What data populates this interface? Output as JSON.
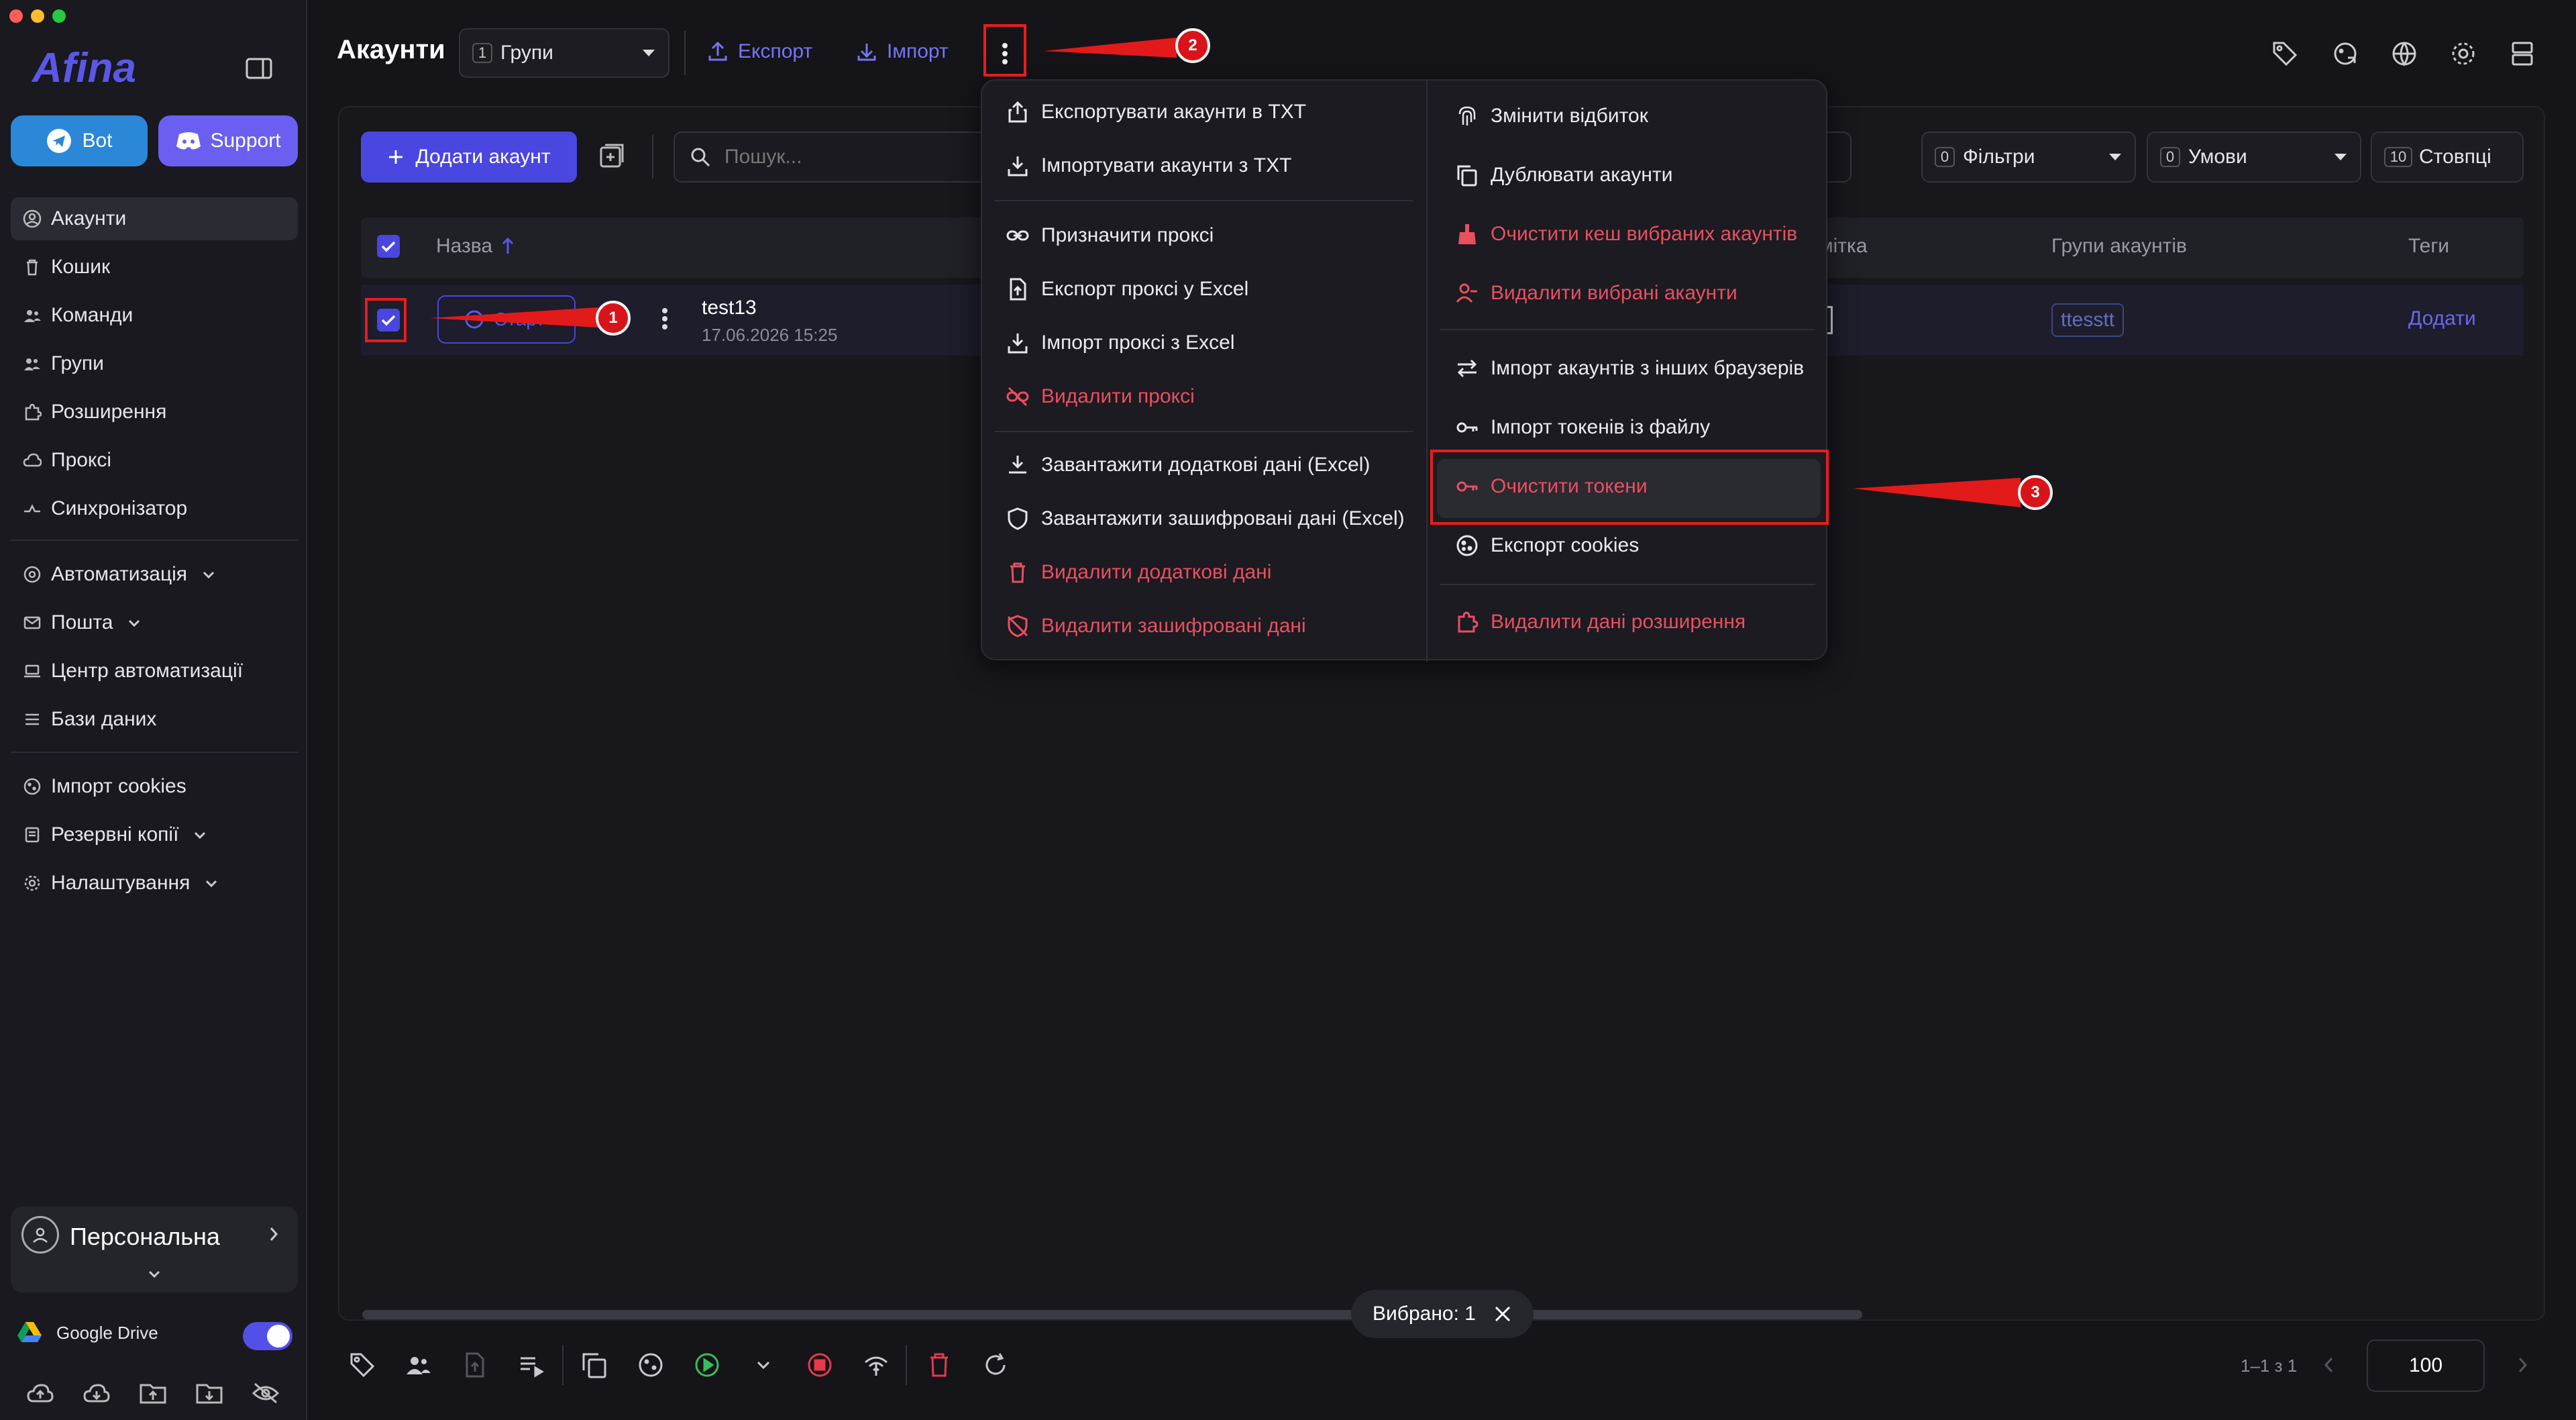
{
  "colors": {
    "accent": "#4a46e0",
    "danger": "#ea4f5f",
    "annotation": "#ea1c1c"
  },
  "sidebar": {
    "logo": "Afina",
    "bot_label": "Bot",
    "support_label": "Support",
    "items": [
      {
        "label": "Акаунти",
        "icon": "user-circle-icon"
      },
      {
        "label": "Кошик",
        "icon": "trash-icon"
      },
      {
        "label": "Команди",
        "icon": "team-icon"
      },
      {
        "label": "Групи",
        "icon": "group-icon"
      },
      {
        "label": "Розширення",
        "icon": "puzzle-icon"
      },
      {
        "label": "Проксі",
        "icon": "cloud-icon"
      },
      {
        "label": "Синхронізатор",
        "icon": "sync-icon"
      },
      {
        "label": "Автоматизація",
        "icon": "automation-icon"
      },
      {
        "label": "Пошта",
        "icon": "mail-icon"
      },
      {
        "label": "Центр автоматизації",
        "icon": "laptop-icon"
      },
      {
        "label": "Бази даних",
        "icon": "list-icon"
      },
      {
        "label": "Імпорт cookies",
        "icon": "cookie-icon"
      },
      {
        "label": "Резервні копії",
        "icon": "backup-icon"
      },
      {
        "label": "Налаштування",
        "icon": "gear-icon"
      }
    ],
    "profile_label": "Персональна",
    "drive_label": "Google Drive",
    "drive_enabled": true
  },
  "header": {
    "title": "Акаунти",
    "groups_count": "1",
    "groups_label": "Групи",
    "export_label": "Експорт",
    "import_label": "Імпорт"
  },
  "toolbar": {
    "add_label": "Додати акаунт",
    "search_placeholder": "Пошук...",
    "filters_count": "0",
    "filters_label": "Фільтри",
    "conditions_count": "0",
    "conditions_label": "Умови",
    "columns_count": "10",
    "columns_label": "Стовпці"
  },
  "table": {
    "headers": {
      "name": "Назва",
      "note": "мітка",
      "groups": "Групи акаунтів",
      "tags": "Теги"
    },
    "rows": [
      {
        "name": "test13",
        "date": "17.06.2026 15:25",
        "group": "ttesstt",
        "tags_action": "Додати",
        "start_label": "Старт"
      }
    ]
  },
  "menu": {
    "left": [
      {
        "label": "Експортувати акаунти в TXT",
        "icon": "export-icon",
        "danger": false
      },
      {
        "label": "Імпортувати акаунти з TXT",
        "icon": "import-icon",
        "danger": false
      },
      {
        "label": "Призначити проксі",
        "icon": "link-icon",
        "danger": false
      },
      {
        "label": "Експорт проксі у Excel",
        "icon": "file-export-icon",
        "danger": false
      },
      {
        "label": "Імпорт проксі з Excel",
        "icon": "download-icon",
        "danger": false
      },
      {
        "label": "Видалити проксі",
        "icon": "link-off-icon",
        "danger": true
      },
      {
        "label": "Завантажити додаткові дані (Excel)",
        "icon": "download-tray-icon",
        "danger": false
      },
      {
        "label": "Завантажити зашифровані дані (Excel)",
        "icon": "shield-icon",
        "danger": false
      },
      {
        "label": "Видалити додаткові дані",
        "icon": "trash-icon",
        "danger": true
      },
      {
        "label": "Видалити зашифровані дані",
        "icon": "shield-off-icon",
        "danger": true
      }
    ],
    "right": [
      {
        "label": "Змінити відбиток",
        "icon": "fingerprint-icon",
        "danger": false
      },
      {
        "label": "Дублювати акаунти",
        "icon": "copy-icon",
        "danger": false
      },
      {
        "label": "Очистити кеш вибраних акаунтів",
        "icon": "broom-icon",
        "danger": true
      },
      {
        "label": "Видалити вибрані акаунти",
        "icon": "user-minus-icon",
        "danger": true
      },
      {
        "label": "Імпорт акаунтів з інших браузерів",
        "icon": "swap-icon",
        "danger": false
      },
      {
        "label": "Імпорт токенів із файлу",
        "icon": "key-icon",
        "danger": false
      },
      {
        "label": "Очистити токени",
        "icon": "key-icon",
        "danger": true
      },
      {
        "label": "Експорт cookies",
        "icon": "cookie-icon",
        "danger": false
      },
      {
        "label": "Видалити дані розширення",
        "icon": "puzzle-icon",
        "danger": true
      }
    ]
  },
  "annotations": {
    "step1": "1",
    "step2": "2",
    "step3": "3"
  },
  "footer": {
    "selected_label": "Вибрано: 1",
    "pagination": "1–1 з 1",
    "page_size": "100"
  }
}
